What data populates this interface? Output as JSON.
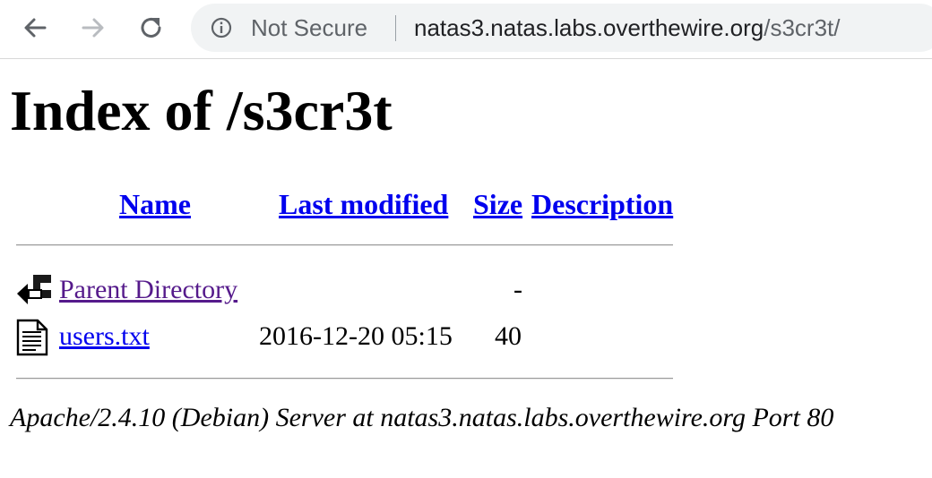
{
  "browser": {
    "security_label": "Not Secure",
    "url_host": "natas3.natas.labs.overthewire.org",
    "url_path": "/s3cr3t/"
  },
  "page": {
    "title": "Index of /s3cr3t",
    "columns": {
      "name": "Name",
      "last_modified": "Last modified",
      "size": "Size",
      "description": "Description"
    },
    "rows": [
      {
        "icon": "back-icon",
        "name": "Parent Directory",
        "last_modified": "",
        "size": "-",
        "description": ""
      },
      {
        "icon": "text-file-icon",
        "name": "users.txt",
        "last_modified": "2016-12-20 05:15",
        "size": "40",
        "description": ""
      }
    ],
    "footer": "Apache/2.4.10 (Debian) Server at natas3.natas.labs.overthewire.org Port 80"
  },
  "colors": {
    "link": "#0000ee",
    "visited_link": "#551a8b",
    "omnibox_bg": "#f1f3f4"
  }
}
